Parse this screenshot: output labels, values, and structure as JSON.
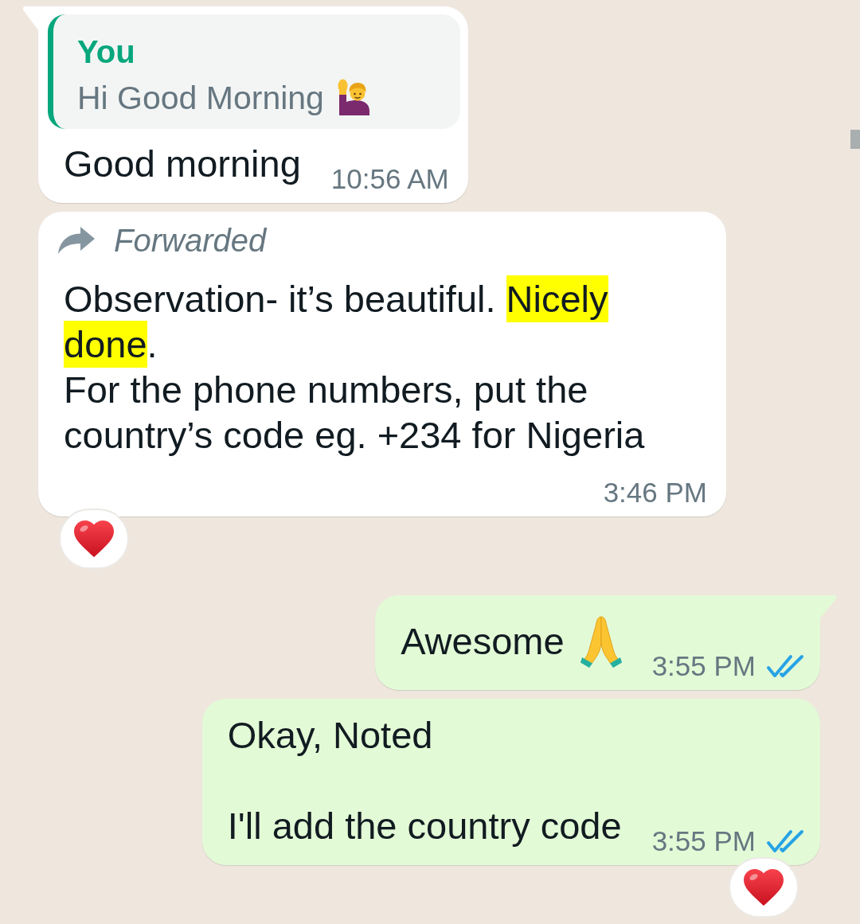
{
  "chat": {
    "messages": [
      {
        "kind": "incoming",
        "first_in_group": true,
        "quote": {
          "author": "You",
          "text": "Hi Good Morning"
        },
        "body": [
          {
            "text": "Good morning",
            "highlighted": false
          }
        ],
        "time": "10:56 AM",
        "reacted": false
      },
      {
        "kind": "incoming",
        "first_in_group": false,
        "forwarded_label": "Forwarded",
        "body": [
          {
            "text": "Observation- it’s beautiful. ",
            "highlighted": false
          },
          {
            "text": "Nicely done",
            "highlighted": true
          },
          {
            "text": ".\nFor the phone numbers, put the country’s code eg. +234 for Nigeria",
            "highlighted": false
          }
        ],
        "time": "3:46 PM",
        "reacted": true
      },
      {
        "kind": "outgoing",
        "first_in_group": true,
        "body": [
          {
            "text": "Awesome",
            "highlighted": false
          }
        ],
        "time": "3:55 PM",
        "read": true,
        "reacted": false
      },
      {
        "kind": "outgoing",
        "first_in_group": false,
        "body": [
          {
            "text": "Okay, Noted\n\nI'll add the country code",
            "highlighted": false
          }
        ],
        "time": "3:55 PM",
        "read": true,
        "reacted": true
      }
    ]
  }
}
